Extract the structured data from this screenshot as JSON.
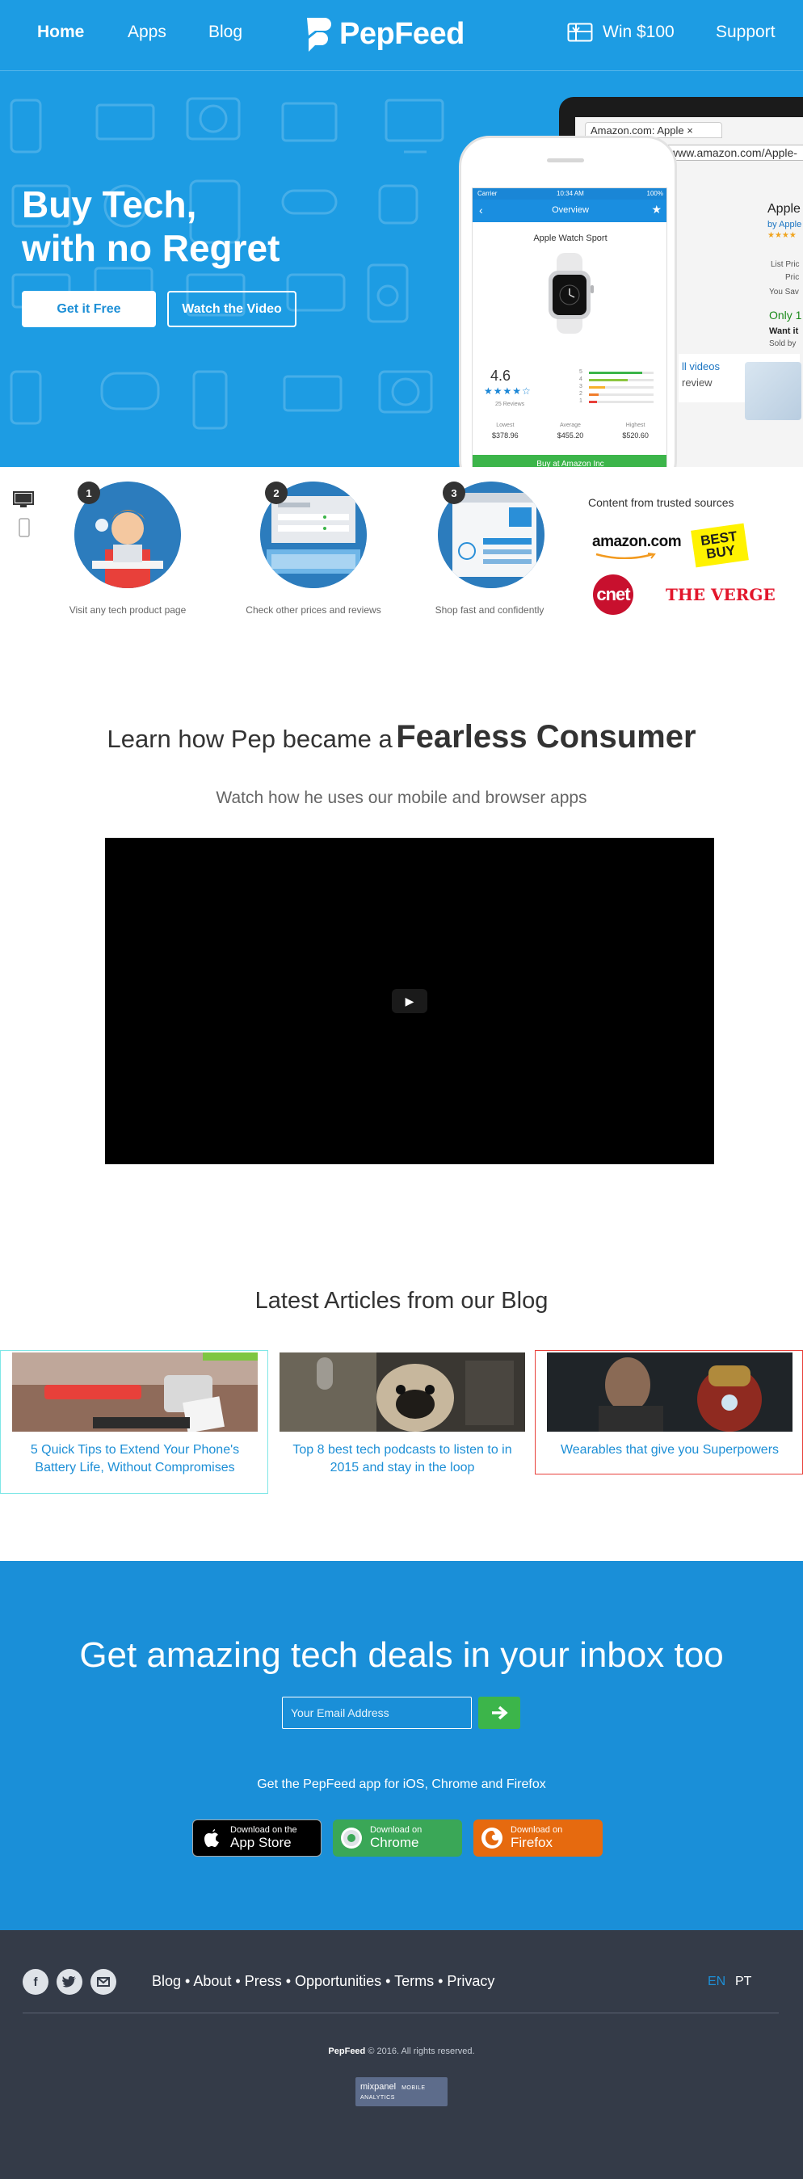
{
  "nav": {
    "home": "Home",
    "apps": "Apps",
    "blog": "Blog",
    "logo_text": "PepFeed",
    "win": "Win $100",
    "support": "Support"
  },
  "hero": {
    "title_line1": "Buy Tech,",
    "title_line2": "with no Regret",
    "get_free": "Get it Free",
    "watch_video": "Watch the Video",
    "browser_tab": "Amazon.com: Apple",
    "browser_url": "www.amazon.com/Apple-",
    "amazon_title": "Apple",
    "amazon_by": "by Apple",
    "amazon_list_price": "List Pric",
    "amazon_price": "Pric",
    "amazon_save": "You Sav",
    "amazon_only": "Only 1",
    "amazon_want": "Want it",
    "amazon_sold": "Sold by",
    "amazon_videos": "ll videos",
    "amazon_review": "review",
    "phone": {
      "carrier": "Carrier",
      "time": "10:34 AM",
      "battery": "100%",
      "screen_title": "Overview",
      "product": "Apple Watch Sport",
      "rating": "4.6",
      "reviews": "25 Reviews",
      "bars": [
        {
          "label": "5",
          "fill": 0.82,
          "color": "#3cb54a"
        },
        {
          "label": "4",
          "fill": 0.6,
          "color": "#8cc63f"
        },
        {
          "label": "3",
          "fill": 0.25,
          "color": "#f7b12c"
        },
        {
          "label": "2",
          "fill": 0.15,
          "color": "#f07d2c"
        },
        {
          "label": "1",
          "fill": 0.12,
          "color": "#e8403a"
        }
      ],
      "lowest_label": "Lowest",
      "lowest": "$378.96",
      "average_label": "Average",
      "average": "$455.20",
      "highest_label": "Highest",
      "highest": "$520.60",
      "buy": "Buy at Amazon Inc"
    }
  },
  "steps": [
    {
      "num": "1",
      "label": "Visit any tech product page"
    },
    {
      "num": "2",
      "label": "Check other prices and reviews"
    },
    {
      "num": "3",
      "label": "Shop fast and confidently"
    }
  ],
  "trusted": {
    "title": "Content from trusted sources",
    "amazon": "amazon.com",
    "bestbuy": "BEST BUY",
    "cnet": "cnet",
    "verge": "THE VERGE"
  },
  "learn": {
    "title_light": "Learn how Pep became a",
    "title_bold": "Fearless Consumer",
    "subtitle": "Watch how he uses our mobile and browser apps"
  },
  "blog": {
    "title": "Latest Articles from our Blog",
    "articles": [
      {
        "title": "5 Quick Tips to Extend Your Phone's Battery Life, Without Compromises",
        "border": "#7fe7e7"
      },
      {
        "title": "Top 8 best tech podcasts to listen to in 2015 and stay in the loop",
        "border": "transparent"
      },
      {
        "title": "Wearables that give you Superpowers",
        "border": "#e8403a"
      }
    ]
  },
  "newsletter": {
    "title": "Get amazing tech deals in your inbox too",
    "email_placeholder": "Your Email Address",
    "get_app": "Get the PepFeed app for iOS, Chrome and Firefox",
    "appstore_small": "Download on the",
    "appstore_big": "App Store",
    "chrome_small": "Download on",
    "chrome_big": "Chrome",
    "firefox_small": "Download on",
    "firefox_big": "Firefox"
  },
  "footer": {
    "links": [
      "Blog",
      "About",
      "Press",
      "Opportunities",
      "Terms",
      "Privacy"
    ],
    "separator": " • ",
    "lang_en": "EN",
    "lang_pt": "PT",
    "brand": "PepFeed",
    "copyright": " © 2016. All rights reserved.",
    "mixpanel": "mixpanel",
    "mixpanel_sub": "MOBILE ANALYTICS"
  },
  "colors": {
    "brand_blue": "#1d9ce3",
    "newsletter_blue": "#1a8fd8",
    "footer_bg": "#343b48",
    "green": "#3cb54a",
    "firefox_orange": "#e66a0f",
    "chrome_green": "#3aa757"
  }
}
